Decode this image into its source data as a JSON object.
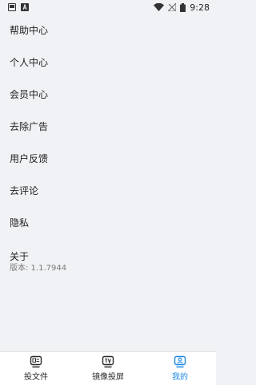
{
  "status_bar": {
    "time": "9:28",
    "left_icons": [
      "notification-box-icon",
      "a-box-icon"
    ],
    "right_icons": [
      "wifi-icon",
      "no-signal-icon",
      "battery-icon"
    ]
  },
  "menu": {
    "items": [
      {
        "label": "帮助中心"
      },
      {
        "label": "个人中心"
      },
      {
        "label": "会员中心"
      },
      {
        "label": "去除广告"
      },
      {
        "label": "用户反馈"
      },
      {
        "label": "去评论"
      },
      {
        "label": "隐私"
      },
      {
        "label": "关于"
      }
    ],
    "version": "版本: 1.1.7944"
  },
  "tab_bar": {
    "tabs": [
      {
        "label": "投文件",
        "icon": "file-cast-icon",
        "active": false
      },
      {
        "label": "镜像投屏",
        "icon": "tv-mirror-icon",
        "active": false
      },
      {
        "label": "我的",
        "icon": "profile-icon",
        "active": true
      }
    ]
  },
  "colors": {
    "background": "#f1f2f5",
    "accent": "#1e88e5",
    "tab_bar_bg": "#ffffff"
  }
}
